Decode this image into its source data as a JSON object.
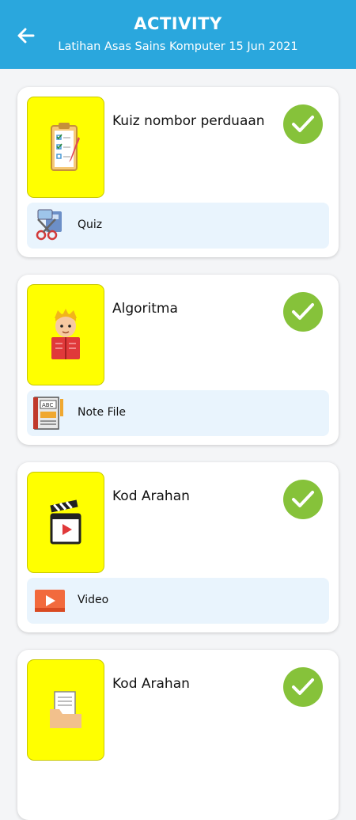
{
  "header": {
    "back_icon": "arrow-left-icon",
    "title": "ACTIVITY",
    "subtitle": "Latihan Asas Sains Komputer 15 Jun 2021"
  },
  "colors": {
    "header_bg": "#2aa7dd",
    "thumb_bg": "#ffff00",
    "check_bg": "#86c23a",
    "type_bar_bg": "#e9f4fd"
  },
  "activities": [
    {
      "title": "Kuiz nombor perduaan",
      "type_label": "Quiz",
      "thumb_icon": "clipboard-checklist-icon",
      "type_icon": "quiz-tools-icon",
      "completed": true
    },
    {
      "title": "Algoritma",
      "type_label": "Note File",
      "thumb_icon": "reading-boy-icon",
      "type_icon": "note-file-icon",
      "completed": true
    },
    {
      "title": "Kod Arahan",
      "type_label": "Video",
      "thumb_icon": "clapperboard-icon",
      "type_icon": "video-icon",
      "completed": true
    },
    {
      "title": "Kod Arahan",
      "type_label": "",
      "thumb_icon": "document-folder-icon",
      "type_icon": "",
      "completed": true
    }
  ]
}
